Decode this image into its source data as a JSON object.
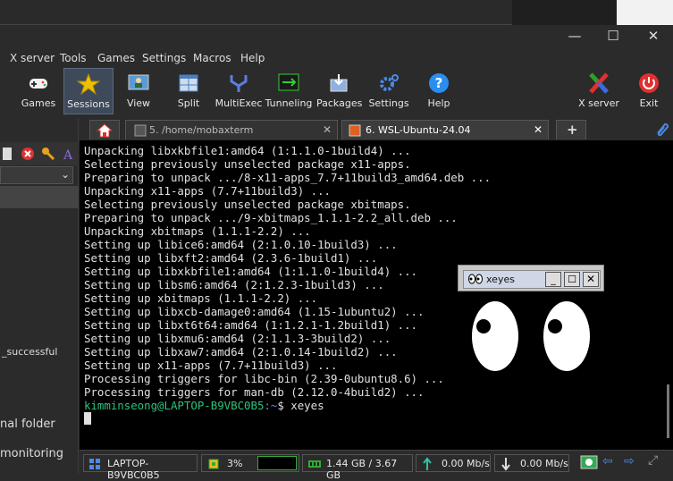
{
  "menu": [
    "X server",
    "Tools",
    "Games",
    "Settings",
    "Macros",
    "Help"
  ],
  "toolbar": {
    "games": "Games",
    "sessions": "Sessions",
    "view": "View",
    "split": "Split",
    "multiexec": "MultiExec",
    "tunneling": "Tunneling",
    "packages": "Packages",
    "settings": "Settings",
    "help": "Help",
    "xserver": "X server",
    "exit": "Exit"
  },
  "tabs": {
    "tab5": "5. /home/mobaxterm",
    "tab6": "6. WSL-Ubuntu-24.04"
  },
  "sidebar": {
    "item1": "_successful",
    "item2": "nal folder",
    "item3": "monitoring"
  },
  "terminal": {
    "lines": [
      "Unpacking libxkbfile1:amd64 (1:1.1.0-1build4) ...",
      "Selecting previously unselected package x11-apps.",
      "Preparing to unpack .../8-x11-apps_7.7+11build3_amd64.deb ...",
      "Unpacking x11-apps (7.7+11build3) ...",
      "Selecting previously unselected package xbitmaps.",
      "Preparing to unpack .../9-xbitmaps_1.1.1-2.2_all.deb ...",
      "Unpacking xbitmaps (1.1.1-2.2) ...",
      "Setting up libice6:amd64 (2:1.0.10-1build3) ...",
      "Setting up libxft2:amd64 (2.3.6-1build1) ...",
      "Setting up libxkbfile1:amd64 (1:1.1.0-1build4) ...",
      "Setting up libsm6:amd64 (2:1.2.3-1build3) ...",
      "Setting up xbitmaps (1.1.1-2.2) ...",
      "Setting up libxcb-damage0:amd64 (1.15-1ubuntu2) ...",
      "Setting up libxt6t64:amd64 (1:1.2.1-1.2build1) ...",
      "Setting up libxmu6:amd64 (2:1.1.3-3build2) ...",
      "Setting up libxaw7:amd64 (2:1.0.14-1build2) ...",
      "Setting up x11-apps (7.7+11build3) ...",
      "Processing triggers for libc-bin (2.39-0ubuntu8.6) ...",
      "Processing triggers for man-db (2.12.0-4build2) ..."
    ],
    "prompt_user": "kimminseong@LAPTOP-B9VBC0B5",
    "prompt_path": ":~",
    "prompt_cmd": "$ xeyes"
  },
  "xeyes": {
    "title": "xeyes"
  },
  "status": {
    "host": "LAPTOP-B9VBC0B5",
    "cpu": "3%",
    "mem": "1.44 GB / 3.67 GB",
    "up": "0.00 Mb/s",
    "down": "0.00 Mb/s"
  },
  "colors": {
    "prompt": "#2ec27e",
    "accent": "#f0c000"
  }
}
